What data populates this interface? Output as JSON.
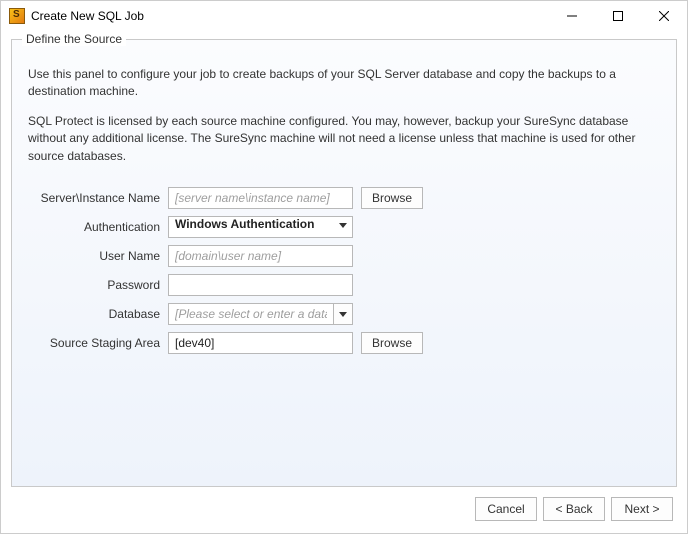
{
  "window": {
    "title": "Create New SQL Job"
  },
  "section": {
    "legend": "Define the Source",
    "desc1": "Use this panel to configure your job to create backups of your SQL Server database and copy the backups to a destination machine.",
    "desc2": "SQL Protect is licensed by each source machine configured. You may, however, backup your SureSync database without any additional license. The SureSync machine will not need a license unless that machine is used for other source databases."
  },
  "form": {
    "server_label": "Server\\Instance Name",
    "server_placeholder": "[server name\\instance name]",
    "server_value": "",
    "server_browse": "Browse",
    "auth_label": "Authentication",
    "auth_value": "Windows Authentication",
    "user_label": "User Name",
    "user_placeholder": "[domain\\user name]",
    "user_value": "",
    "pass_label": "Password",
    "pass_value": "",
    "db_label": "Database",
    "db_placeholder": "[Please select or enter a database]",
    "db_value": "",
    "staging_label": "Source Staging Area",
    "staging_value": "[dev40]",
    "staging_browse": "Browse"
  },
  "buttons": {
    "cancel": "Cancel",
    "back": "< Back",
    "next": "Next >"
  }
}
